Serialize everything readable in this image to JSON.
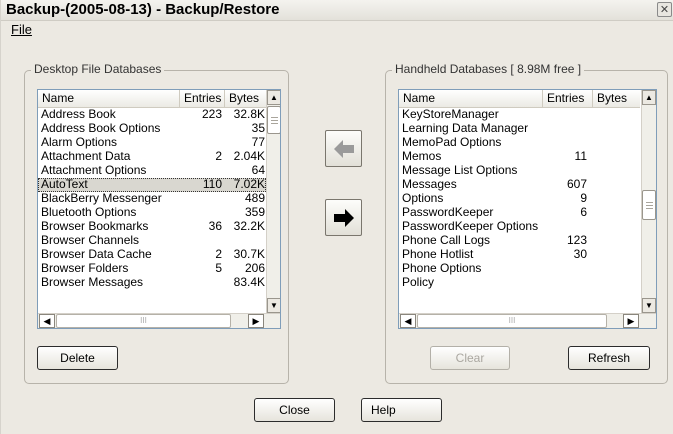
{
  "window": {
    "title": "Backup-(2005-08-13) - Backup/Restore",
    "close_glyph": "✕"
  },
  "menu": {
    "file": "File"
  },
  "desktop": {
    "group_label": "Desktop File Databases",
    "columns": {
      "name": "Name",
      "entries": "Entries",
      "bytes": "Bytes"
    },
    "rows": [
      {
        "name": "Address Book",
        "entries": "223",
        "bytes": "32.8K"
      },
      {
        "name": "Address Book Options",
        "entries": "",
        "bytes": "35"
      },
      {
        "name": "Alarm Options",
        "entries": "",
        "bytes": "77"
      },
      {
        "name": "Attachment Data",
        "entries": "2",
        "bytes": "2.04K"
      },
      {
        "name": "Attachment Options",
        "entries": "",
        "bytes": "64"
      },
      {
        "name": "AutoText",
        "entries": "110",
        "bytes": "7.02K",
        "selected": true
      },
      {
        "name": "BlackBerry Messenger",
        "entries": "",
        "bytes": "489"
      },
      {
        "name": "Bluetooth Options",
        "entries": "",
        "bytes": "359"
      },
      {
        "name": "Browser Bookmarks",
        "entries": "36",
        "bytes": "32.2K"
      },
      {
        "name": "Browser Channels",
        "entries": "",
        "bytes": ""
      },
      {
        "name": "Browser Data Cache",
        "entries": "2",
        "bytes": "30.7K"
      },
      {
        "name": "Browser Folders",
        "entries": "5",
        "bytes": "206"
      },
      {
        "name": "Browser Messages",
        "entries": "",
        "bytes": "83.4K"
      }
    ],
    "delete_label": "Delete"
  },
  "handheld": {
    "group_label": "Handheld Databases [ 8.98M free ]",
    "columns": {
      "name": "Name",
      "entries": "Entries",
      "bytes": "Bytes"
    },
    "rows": [
      {
        "name": "KeyStoreManager",
        "entries": "",
        "bytes": ""
      },
      {
        "name": "Learning Data Manager",
        "entries": "",
        "bytes": ""
      },
      {
        "name": "MemoPad Options",
        "entries": "",
        "bytes": ""
      },
      {
        "name": "Memos",
        "entries": "11",
        "bytes": ""
      },
      {
        "name": "Message List Options",
        "entries": "",
        "bytes": ""
      },
      {
        "name": "Messages",
        "entries": "607",
        "bytes": ""
      },
      {
        "name": "Options",
        "entries": "9",
        "bytes": ""
      },
      {
        "name": "PasswordKeeper",
        "entries": "6",
        "bytes": ""
      },
      {
        "name": "PasswordKeeper Options",
        "entries": "",
        "bytes": ""
      },
      {
        "name": "Phone Call Logs",
        "entries": "123",
        "bytes": ""
      },
      {
        "name": "Phone Hotlist",
        "entries": "30",
        "bytes": ""
      },
      {
        "name": "Phone Options",
        "entries": "",
        "bytes": ""
      },
      {
        "name": "Policy",
        "entries": "",
        "bytes": ""
      }
    ],
    "clear_label": "Clear",
    "refresh_label": "Refresh"
  },
  "transfer": {
    "to_desktop_icon": "arrow-left-icon",
    "to_handheld_icon": "arrow-right-icon",
    "to_desktop_color": "#9a9a9a",
    "to_handheld_color": "#000000"
  },
  "footer": {
    "close_label": "Close",
    "help_label": "Help"
  },
  "scroll": {
    "up": "▲",
    "down": "▼",
    "left": "◀",
    "right": "▶",
    "thumb_grip": "III"
  }
}
